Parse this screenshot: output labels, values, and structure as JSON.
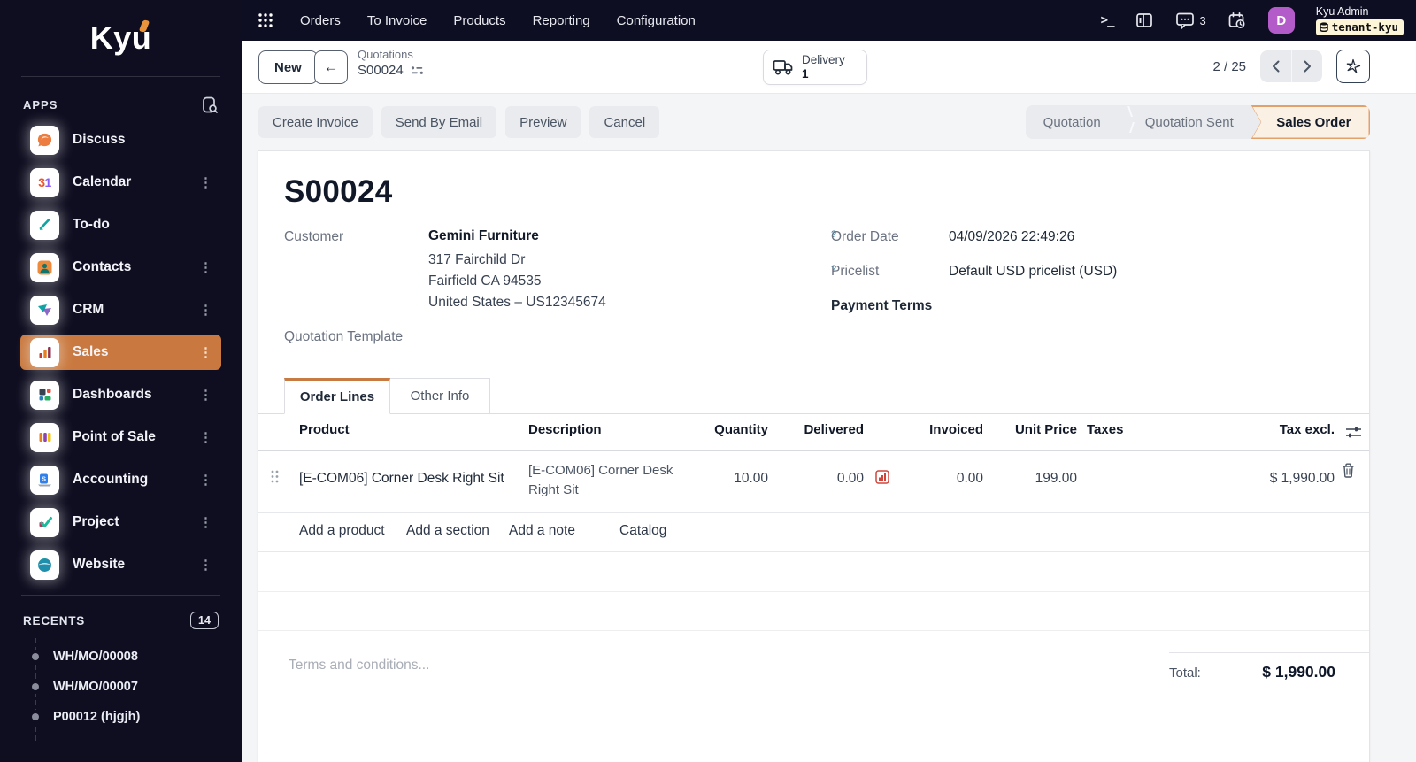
{
  "brand": {
    "logo": "Kyu"
  },
  "topbar": {
    "menus": [
      "Orders",
      "To Invoice",
      "Products",
      "Reporting",
      "Configuration"
    ],
    "message_count": "3",
    "user": {
      "name": "Kyu Admin",
      "tenant": "tenant-kyu",
      "avatar_initial": "D"
    }
  },
  "sidebar": {
    "apps_header": "APPS",
    "apps": [
      {
        "label": "Discuss"
      },
      {
        "label": "Calendar"
      },
      {
        "label": "To-do"
      },
      {
        "label": "Contacts"
      },
      {
        "label": "CRM"
      },
      {
        "label": "Sales"
      },
      {
        "label": "Dashboards"
      },
      {
        "label": "Point of Sale"
      },
      {
        "label": "Accounting"
      },
      {
        "label": "Project"
      },
      {
        "label": "Website"
      }
    ],
    "active_app": "Sales",
    "recents_header": "RECENTS",
    "recents_count": "14",
    "recents": [
      "WH/MO/00008",
      "WH/MO/00007",
      "P00012 (hjgjh)"
    ]
  },
  "controlbar": {
    "new_label": "New",
    "breadcrumb_parent": "Quotations",
    "breadcrumb_current": "S00024",
    "delivery": {
      "label": "Delivery",
      "count": "1"
    },
    "pager": "2 / 25"
  },
  "actions": {
    "buttons": [
      "Create Invoice",
      "Send By Email",
      "Preview",
      "Cancel"
    ]
  },
  "statusbar": {
    "steps": [
      "Quotation",
      "Quotation Sent",
      "Sales Order"
    ],
    "active": "Sales Order"
  },
  "order": {
    "title": "S00024",
    "customer_label": "Customer",
    "customer_name": "Gemini Furniture",
    "customer_address": [
      "317 Fairchild Dr",
      "Fairfield CA 94535",
      "United States – US12345674"
    ],
    "order_date_label": "Order Date",
    "order_date": "04/09/2026 22:49:26",
    "pricelist_label": "Pricelist",
    "pricelist": "Default USD pricelist (USD)",
    "payment_terms_label": "Payment Terms",
    "quotation_template_label": "Quotation Template"
  },
  "tabs": [
    "Order Lines",
    "Other Info"
  ],
  "lines": {
    "headers": [
      "Product",
      "Description",
      "Quantity",
      "Delivered",
      "Invoiced",
      "Unit Price",
      "Taxes",
      "Tax excl."
    ],
    "rows": [
      {
        "product": "[E-COM06] Corner Desk Right Sit",
        "description": "[E-COM06] Corner Desk Right Sit",
        "quantity": "10.00",
        "delivered": "0.00",
        "invoiced": "0.00",
        "unit_price": "199.00",
        "taxes": "",
        "subtotal": "$ 1,990.00"
      }
    ],
    "footer_links": [
      "Add a product",
      "Add a section",
      "Add a note"
    ],
    "catalog_label": "Catalog"
  },
  "totals": {
    "terms_placeholder": "Terms and conditions...",
    "total_label": "Total:",
    "total_value": "$ 1,990.00"
  },
  "icons": {
    "terminal-icon": ">_",
    "kebab-icon": "⋮",
    "back-arrow-icon": "←",
    "help-icon": "?"
  },
  "colors": {
    "sidebar_bg": "#0e0e20",
    "accent_orange": "#c9793f",
    "statusbar_active_bg": "#fbf0e4",
    "statusbar_active_border": "#e2a06b",
    "avatar_purple": "#b35bc9",
    "tenant_badge_bg": "#fcf5d8",
    "danger_red": "#d0453b"
  }
}
